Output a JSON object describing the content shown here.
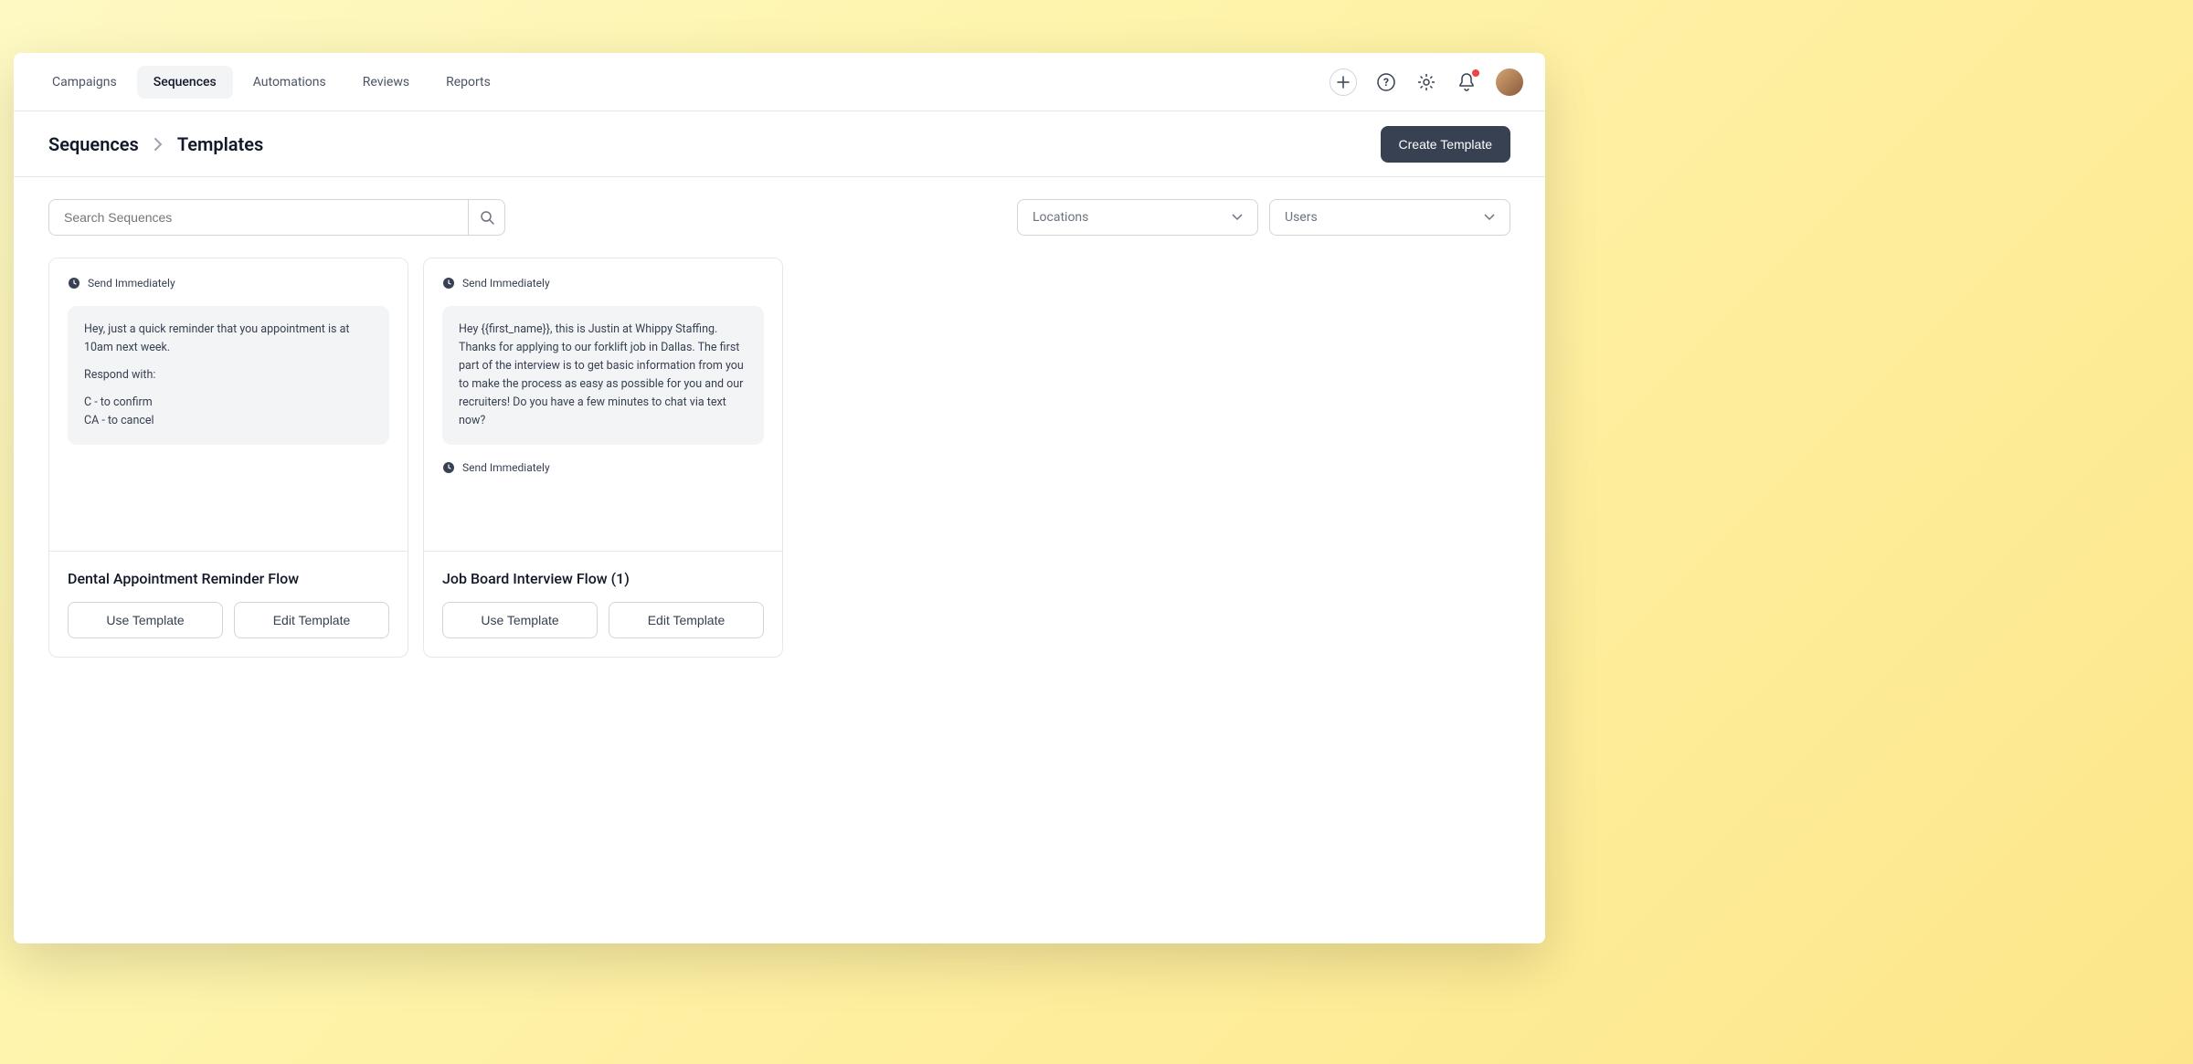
{
  "nav": {
    "tabs": [
      {
        "label": "Campaigns",
        "active": false
      },
      {
        "label": "Sequences",
        "active": true
      },
      {
        "label": "Automations",
        "active": false
      },
      {
        "label": "Reviews",
        "active": false
      },
      {
        "label": "Reports",
        "active": false
      }
    ]
  },
  "breadcrumb": {
    "item1": "Sequences",
    "item2": "Templates"
  },
  "header": {
    "create_button": "Create Template"
  },
  "search": {
    "placeholder": "Search Sequences"
  },
  "filters": {
    "locations_label": "Locations",
    "users_label": "Users"
  },
  "templates": [
    {
      "send_label": "Send Immediately",
      "message_p1": "Hey, just a quick reminder that you appointment is at 10am next week.",
      "message_p2": "Respond with:",
      "message_p3": "C - to confirm",
      "message_p4": "CA - to cancel",
      "title": "Dental Appointment Reminder Flow",
      "use_label": "Use Template",
      "edit_label": "Edit Template"
    },
    {
      "send_label": "Send Immediately",
      "message_p1": "Hey {{first_name}}, this is Justin at Whippy Staffing. Thanks for applying to our forklift job in Dallas. The first part of the interview is to get basic information from you to make the process as easy as possible for you and our recruiters! Do you have a few minutes to chat via text now?",
      "send_label_2": "Send Immediately",
      "title": "Job Board Interview Flow (1)",
      "use_label": "Use Template",
      "edit_label": "Edit Template"
    }
  ]
}
